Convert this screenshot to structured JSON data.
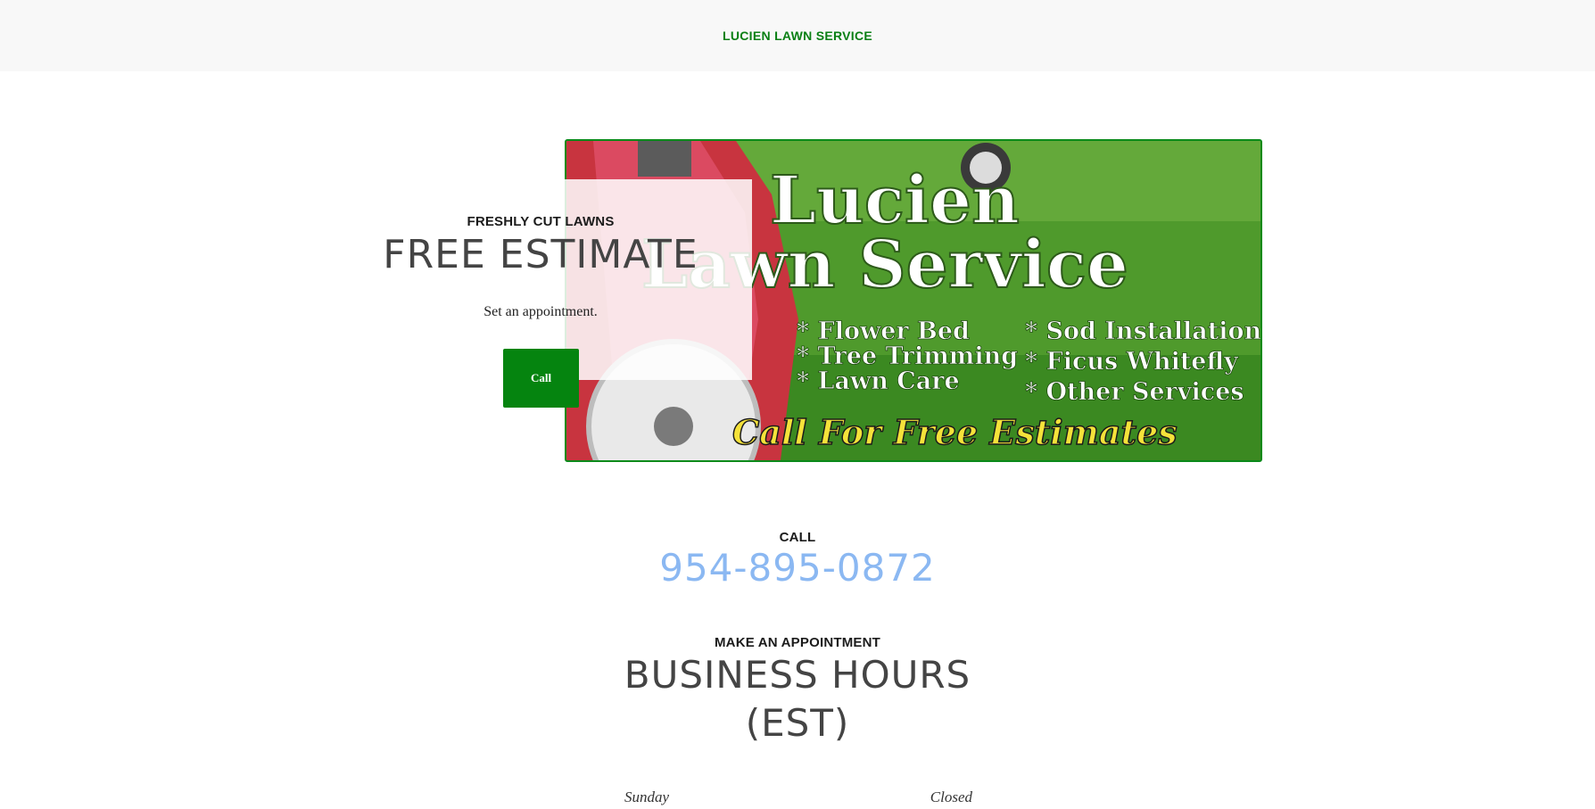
{
  "header": {
    "brand": "LUCIEN LAWN SERVICE"
  },
  "hero": {
    "eyebrow": "FRESHLY CUT LAWNS",
    "title": "FREE ESTIMATE",
    "subtitle": "Set an appointment.",
    "button_label": "Call",
    "banner": {
      "line1": "Lucien",
      "line2": "Lawn Service",
      "services_left": [
        "* Flower Bed",
        "* Tree Trimming",
        "* Lawn Care"
      ],
      "services_right": [
        "* Sod Installation",
        "* Ficus Whitefly",
        "* Other Services"
      ],
      "tagline": "Call For Free Estimates"
    }
  },
  "call": {
    "label": "CALL",
    "phone": "954-895-0872"
  },
  "hours": {
    "eyebrow": "MAKE AN APPOINTMENT",
    "title_line1": "BUSINESS HOURS",
    "title_line2": "(EST)",
    "rows": [
      {
        "day": "Sunday",
        "value": "Closed"
      }
    ]
  },
  "colors": {
    "brand_green": "#0a7f14",
    "button_green": "#05840f",
    "phone_blue": "#8bb8f2"
  }
}
